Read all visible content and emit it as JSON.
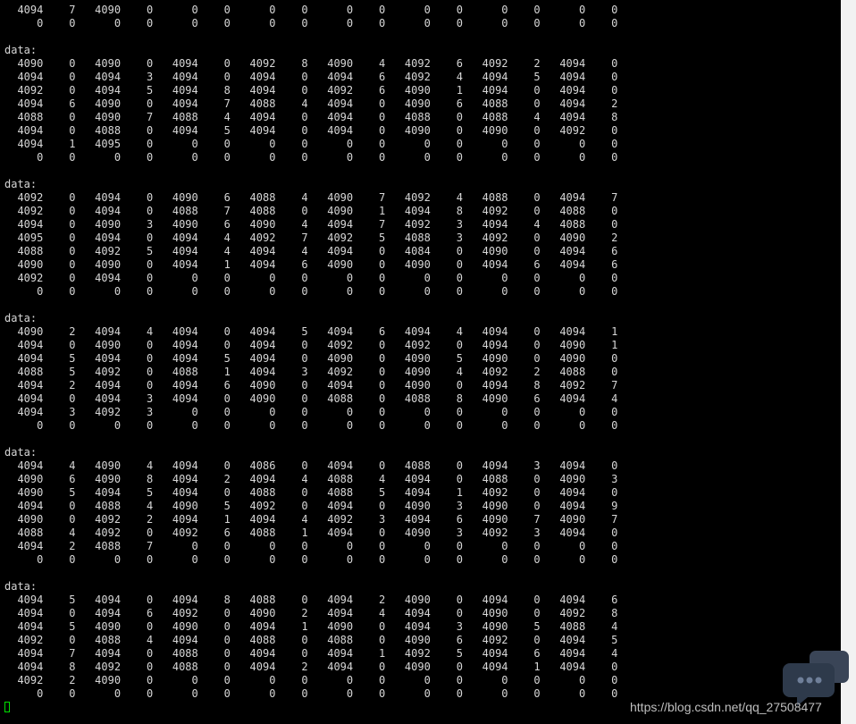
{
  "terminal": {
    "header_label": "data:",
    "top_rows": [
      [
        4094,
        7,
        4090,
        0,
        0,
        0,
        0,
        0,
        0,
        0,
        0,
        0,
        0,
        0,
        0,
        0
      ],
      [
        0,
        0,
        0,
        0,
        0,
        0,
        0,
        0,
        0,
        0,
        0,
        0,
        0,
        0,
        0,
        0
      ]
    ],
    "blocks": [
      {
        "label": "data:",
        "rows": [
          [
            4090,
            0,
            4090,
            0,
            4094,
            0,
            4092,
            8,
            4090,
            4,
            4092,
            6,
            4092,
            2,
            4094,
            0
          ],
          [
            4094,
            0,
            4094,
            3,
            4094,
            0,
            4094,
            0,
            4094,
            6,
            4092,
            4,
            4094,
            5,
            4094,
            0
          ],
          [
            4092,
            0,
            4094,
            5,
            4094,
            8,
            4094,
            0,
            4092,
            6,
            4090,
            1,
            4094,
            0,
            4094,
            0
          ],
          [
            4094,
            6,
            4090,
            0,
            4094,
            7,
            4088,
            4,
            4094,
            0,
            4090,
            6,
            4088,
            0,
            4094,
            2
          ],
          [
            4088,
            0,
            4090,
            7,
            4088,
            4,
            4094,
            0,
            4094,
            0,
            4088,
            0,
            4088,
            4,
            4094,
            8
          ],
          [
            4094,
            0,
            4088,
            0,
            4094,
            5,
            4094,
            0,
            4094,
            0,
            4090,
            0,
            4090,
            0,
            4092,
            0
          ],
          [
            4094,
            1,
            4095,
            0,
            0,
            0,
            0,
            0,
            0,
            0,
            0,
            0,
            0,
            0,
            0,
            0
          ],
          [
            0,
            0,
            0,
            0,
            0,
            0,
            0,
            0,
            0,
            0,
            0,
            0,
            0,
            0,
            0,
            0
          ]
        ]
      },
      {
        "label": "data:",
        "rows": [
          [
            4092,
            0,
            4094,
            0,
            4090,
            6,
            4088,
            4,
            4090,
            7,
            4092,
            4,
            4088,
            0,
            4094,
            7
          ],
          [
            4092,
            0,
            4094,
            0,
            4088,
            7,
            4088,
            0,
            4090,
            1,
            4094,
            8,
            4092,
            0,
            4088,
            0
          ],
          [
            4094,
            0,
            4090,
            3,
            4090,
            6,
            4090,
            4,
            4094,
            7,
            4092,
            3,
            4094,
            4,
            4088,
            0
          ],
          [
            4095,
            0,
            4094,
            0,
            4094,
            4,
            4092,
            7,
            4092,
            5,
            4088,
            3,
            4092,
            0,
            4090,
            2
          ],
          [
            4088,
            0,
            4092,
            5,
            4094,
            4,
            4094,
            4,
            4094,
            0,
            4084,
            0,
            4090,
            0,
            4094,
            6
          ],
          [
            4090,
            0,
            4090,
            0,
            4094,
            1,
            4094,
            6,
            4090,
            0,
            4090,
            0,
            4094,
            6,
            4094,
            6
          ],
          [
            4092,
            0,
            4094,
            0,
            0,
            0,
            0,
            0,
            0,
            0,
            0,
            0,
            0,
            0,
            0,
            0
          ],
          [
            0,
            0,
            0,
            0,
            0,
            0,
            0,
            0,
            0,
            0,
            0,
            0,
            0,
            0,
            0,
            0
          ]
        ]
      },
      {
        "label": "data:",
        "rows": [
          [
            4090,
            2,
            4094,
            4,
            4094,
            0,
            4094,
            5,
            4094,
            6,
            4094,
            4,
            4094,
            0,
            4094,
            1
          ],
          [
            4094,
            0,
            4090,
            0,
            4094,
            0,
            4094,
            0,
            4092,
            0,
            4092,
            0,
            4094,
            0,
            4090,
            1
          ],
          [
            4094,
            5,
            4094,
            0,
            4094,
            5,
            4094,
            0,
            4090,
            0,
            4090,
            5,
            4090,
            0,
            4090,
            0
          ],
          [
            4088,
            5,
            4092,
            0,
            4088,
            1,
            4094,
            3,
            4092,
            0,
            4090,
            4,
            4092,
            2,
            4088,
            0
          ],
          [
            4094,
            2,
            4094,
            0,
            4094,
            6,
            4090,
            0,
            4094,
            0,
            4090,
            0,
            4094,
            8,
            4092,
            7
          ],
          [
            4094,
            0,
            4094,
            3,
            4094,
            0,
            4090,
            0,
            4088,
            0,
            4088,
            8,
            4090,
            6,
            4094,
            4
          ],
          [
            4094,
            3,
            4092,
            3,
            0,
            0,
            0,
            0,
            0,
            0,
            0,
            0,
            0,
            0,
            0,
            0
          ],
          [
            0,
            0,
            0,
            0,
            0,
            0,
            0,
            0,
            0,
            0,
            0,
            0,
            0,
            0,
            0,
            0
          ]
        ]
      },
      {
        "label": "data:",
        "rows": [
          [
            4094,
            4,
            4090,
            4,
            4094,
            0,
            4086,
            0,
            4094,
            0,
            4088,
            0,
            4094,
            3,
            4094,
            0
          ],
          [
            4090,
            6,
            4090,
            8,
            4094,
            2,
            4094,
            4,
            4088,
            4,
            4094,
            0,
            4088,
            0,
            4090,
            3
          ],
          [
            4090,
            5,
            4094,
            5,
            4094,
            0,
            4088,
            0,
            4088,
            5,
            4094,
            1,
            4092,
            0,
            4094,
            0
          ],
          [
            4094,
            0,
            4088,
            4,
            4090,
            5,
            4092,
            0,
            4094,
            0,
            4090,
            3,
            4090,
            0,
            4094,
            9
          ],
          [
            4090,
            0,
            4092,
            2,
            4094,
            1,
            4094,
            4,
            4092,
            3,
            4094,
            6,
            4090,
            7,
            4090,
            7
          ],
          [
            4088,
            4,
            4092,
            0,
            4092,
            6,
            4088,
            1,
            4094,
            0,
            4090,
            3,
            4092,
            3,
            4094,
            0
          ],
          [
            4094,
            2,
            4088,
            7,
            0,
            0,
            0,
            0,
            0,
            0,
            0,
            0,
            0,
            0,
            0,
            0
          ],
          [
            0,
            0,
            0,
            0,
            0,
            0,
            0,
            0,
            0,
            0,
            0,
            0,
            0,
            0,
            0,
            0
          ]
        ]
      },
      {
        "label": "data:",
        "rows": [
          [
            4094,
            5,
            4094,
            0,
            4094,
            8,
            4088,
            0,
            4094,
            2,
            4090,
            0,
            4094,
            0,
            4094,
            6
          ],
          [
            4094,
            0,
            4094,
            6,
            4092,
            0,
            4090,
            2,
            4094,
            4,
            4094,
            0,
            4090,
            0,
            4092,
            8
          ],
          [
            4094,
            5,
            4090,
            0,
            4090,
            0,
            4094,
            1,
            4090,
            0,
            4094,
            3,
            4090,
            5,
            4088,
            4
          ],
          [
            4092,
            0,
            4088,
            4,
            4094,
            0,
            4088,
            0,
            4088,
            0,
            4090,
            6,
            4092,
            0,
            4094,
            5
          ],
          [
            4094,
            7,
            4094,
            0,
            4088,
            0,
            4094,
            0,
            4094,
            1,
            4092,
            5,
            4094,
            6,
            4094,
            4
          ],
          [
            4094,
            8,
            4092,
            0,
            4088,
            0,
            4094,
            2,
            4094,
            0,
            4090,
            0,
            4094,
            1,
            4094,
            0
          ],
          [
            4092,
            2,
            4090,
            0,
            0,
            0,
            0,
            0,
            0,
            0,
            0,
            0,
            0,
            0,
            0,
            0
          ],
          [
            0,
            0,
            0,
            0,
            0,
            0,
            0,
            0,
            0,
            0,
            0,
            0,
            0,
            0,
            0,
            0
          ]
        ]
      }
    ]
  },
  "watermark": {
    "text": "https://blog.csdn.net/qq_27508477"
  },
  "icons": {
    "cursor": "block-cursor-icon",
    "chat": "chat-bubble-icon"
  },
  "colors": {
    "background": "#000000",
    "text": "#d7d7d7",
    "cursor": "#00e000",
    "scrollbar": "#f2f2f2"
  }
}
